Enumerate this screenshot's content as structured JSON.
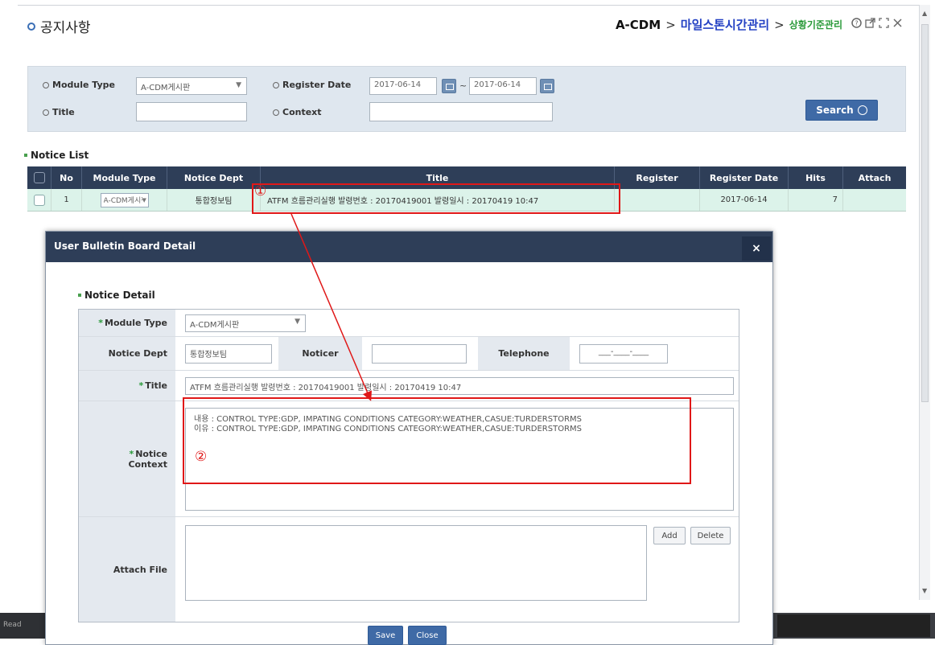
{
  "header": {
    "title": "공지사항",
    "breadcrumb_root": "A-CDM",
    "breadcrumb_sep": ">",
    "breadcrumb_mid": "마일스톤시간관리",
    "breadcrumb_last": "상황기준관리"
  },
  "search": {
    "module_type_label": "Module Type",
    "module_type_value": "A-CDM게시판",
    "register_date_label": "Register Date",
    "date_from": "2017-06-14",
    "date_sep": "~",
    "date_to": "2017-06-14",
    "title_label": "Title",
    "title_value": "",
    "context_label": "Context",
    "context_value": "",
    "search_button": "Search"
  },
  "notice_list": {
    "label": "Notice List",
    "columns": [
      "No",
      "Module Type",
      "Notice Dept",
      "Title",
      "Register",
      "Register Date",
      "Hits",
      "Attach"
    ],
    "rows": [
      {
        "no": "1",
        "module_type": "A-CDM게시판",
        "notice_dept": "통합정보팀",
        "title": "ATFM 흐름관리실행 발령번호 : 20170419001 발령일시 : 20170419 10:47",
        "register": "",
        "register_date": "2017-06-14",
        "hits": "7",
        "attach": ""
      }
    ]
  },
  "modal": {
    "title": "User Bulletin Board Detail",
    "close": "×",
    "section_label": "Notice Detail",
    "module_type_label": "Module Type",
    "module_type_value": "A-CDM게시판",
    "notice_dept_label": "Notice Dept",
    "notice_dept_value": "통합정보팀",
    "noticer_label": "Noticer",
    "noticer_value": "",
    "telephone_label": "Telephone",
    "telephone_value": "___-____-____",
    "title_label": "Title",
    "title_value": "ATFM 흐름관리실행 발령번호 : 20170419001 발령일시 : 20170419 10:47",
    "context_label_1": "Notice",
    "context_label_2": "Context",
    "context_line_1": "내용 : CONTROL TYPE:GDP, IMPATING CONDITIONS CATEGORY:WEATHER,CASUE:TURDERSTORMS",
    "context_line_2": "이유 : CONTROL TYPE:GDP, IMPATING CONDITIONS CATEGORY:WEATHER,CASUE:TURDERSTORMS",
    "attach_label": "Attach File",
    "add_button": "Add",
    "delete_button": "Delete",
    "save_button": "Save",
    "close_button": "Close"
  },
  "annotations": {
    "marker_1": "①",
    "marker_2": "②",
    "color": "#e01818"
  },
  "bottom_bar": {
    "left_text": "Read"
  }
}
